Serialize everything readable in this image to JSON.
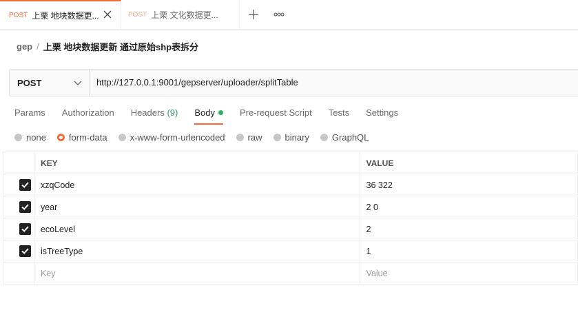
{
  "tabs": [
    {
      "method": "POST",
      "title": "上栗 地块数据更...",
      "active": true
    },
    {
      "method": "POST",
      "title": "上栗 文化数据更...",
      "active": false
    }
  ],
  "breadcrumb": {
    "collection": "gep",
    "separator": "/",
    "name": "上栗 地块数据更新 通过原始shp表拆分"
  },
  "request": {
    "method": "POST",
    "url": "http://127.0.0.1:9001/gepserver/uploader/splitTable"
  },
  "request_tabs": [
    {
      "label": "Params"
    },
    {
      "label": "Authorization"
    },
    {
      "label": "Headers",
      "count": "(9)"
    },
    {
      "label": "Body",
      "active": true
    },
    {
      "label": "Pre-request Script"
    },
    {
      "label": "Tests"
    },
    {
      "label": "Settings"
    }
  ],
  "body_types": [
    "none",
    "form-data",
    "x-www-form-urlencoded",
    "raw",
    "binary",
    "GraphQL"
  ],
  "selected_body_type": "form-data",
  "params_table": {
    "headers": {
      "key": "KEY",
      "value": "VALUE"
    },
    "rows": [
      {
        "key": "xzqCode",
        "value": "36  322",
        "checked": true
      },
      {
        "key": "year",
        "value": "2  0",
        "checked": true
      },
      {
        "key": "ecoLevel",
        "value": "2",
        "checked": true
      },
      {
        "key": "isTreeType",
        "value": "1",
        "checked": true
      }
    ],
    "placeholder": {
      "key": "Key",
      "value": "Value"
    }
  },
  "colors": {
    "accent": "#f26b3a",
    "status_dot": "#2eb55a"
  }
}
